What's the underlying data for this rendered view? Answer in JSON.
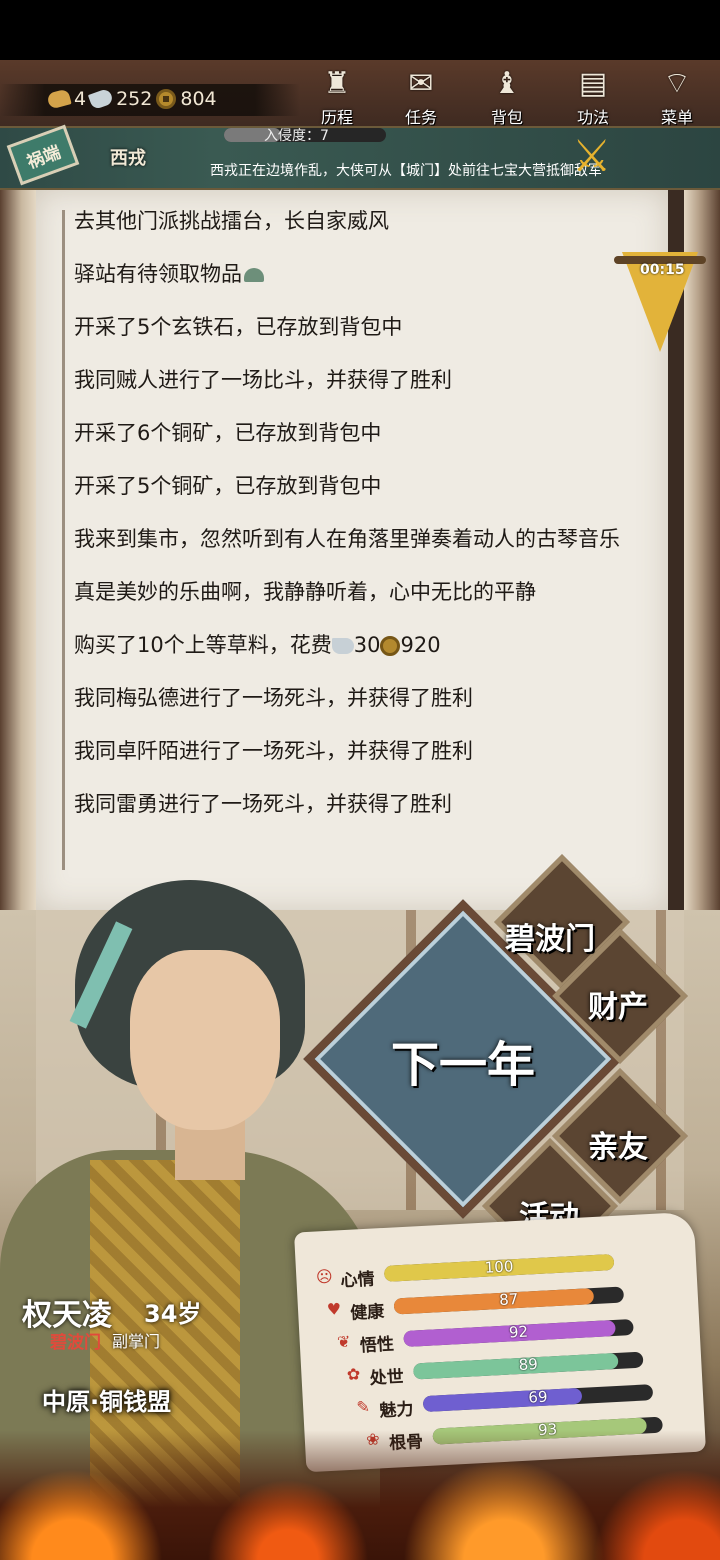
{
  "currency": {
    "gold": "4",
    "silver": "252",
    "coins": "804"
  },
  "nav": [
    {
      "label": "历程",
      "icon": "gourd-icon"
    },
    {
      "label": "任务",
      "icon": "scroll-icon"
    },
    {
      "label": "背包",
      "icon": "bag-icon"
    },
    {
      "label": "功法",
      "icon": "book-icon"
    },
    {
      "label": "菜单",
      "icon": "fan-icon"
    }
  ],
  "invasion": {
    "badge": "祸端",
    "enemy": "西戎",
    "label": "入侵度：7",
    "level": 0.35,
    "message": "西戎正在边境作乱，大侠可从【城门】处前往七宝大营抵御敌军"
  },
  "timer": "00:15",
  "log": [
    {
      "text": "去其他门派挑战擂台，长自家威风"
    },
    {
      "text": "驿站有待领取物品",
      "suffix_icon": "leaf"
    },
    {
      "text": "开采了5个玄铁石，已存放到背包中"
    },
    {
      "text": "我同贼人进行了一场比斗，并获得了胜利"
    },
    {
      "text": "开采了6个铜矿，已存放到背包中"
    },
    {
      "text": "开采了5个铜矿，已存放到背包中"
    },
    {
      "text": "我来到集市，忽然听到有人在角落里弹奏着动人的古琴音乐"
    },
    {
      "text": "真是美妙的乐曲啊，我静静听着，心中无比的平静"
    },
    {
      "text": "购买了10个上等草料，花费",
      "cost_silver": "30",
      "cost_coins": "920"
    },
    {
      "text": "我同梅弘德进行了一场死斗，并获得了胜利"
    },
    {
      "text": "我同卓阡陌进行了一场死斗，并获得了胜利"
    },
    {
      "text": "我同雷勇进行了一场死斗，并获得了胜利"
    }
  ],
  "menu": {
    "main": "下一年",
    "sect": "碧波门",
    "wealth": "财产",
    "relatives": "亲友",
    "activity": "活动"
  },
  "character": {
    "name": "权天凌",
    "age": "34岁",
    "sect": "碧波门",
    "role": "副掌门",
    "region": "中原·铜钱盟"
  },
  "stats": [
    {
      "label": "心情",
      "value": 100,
      "color": "#e0c84a",
      "icon": "face-icon"
    },
    {
      "label": "健康",
      "value": 87,
      "color": "#e8883a",
      "icon": "heart-icon"
    },
    {
      "label": "悟性",
      "value": 92,
      "color": "#b15fd0",
      "icon": "mind-icon"
    },
    {
      "label": "处世",
      "value": 89,
      "color": "#7cc59a",
      "icon": "flower-icon"
    },
    {
      "label": "魅力",
      "value": 69,
      "color": "#6f5fd0",
      "icon": "fan-icon"
    },
    {
      "label": "根骨",
      "value": 93,
      "color": "#a6c87a",
      "icon": "lotus-icon"
    }
  ]
}
